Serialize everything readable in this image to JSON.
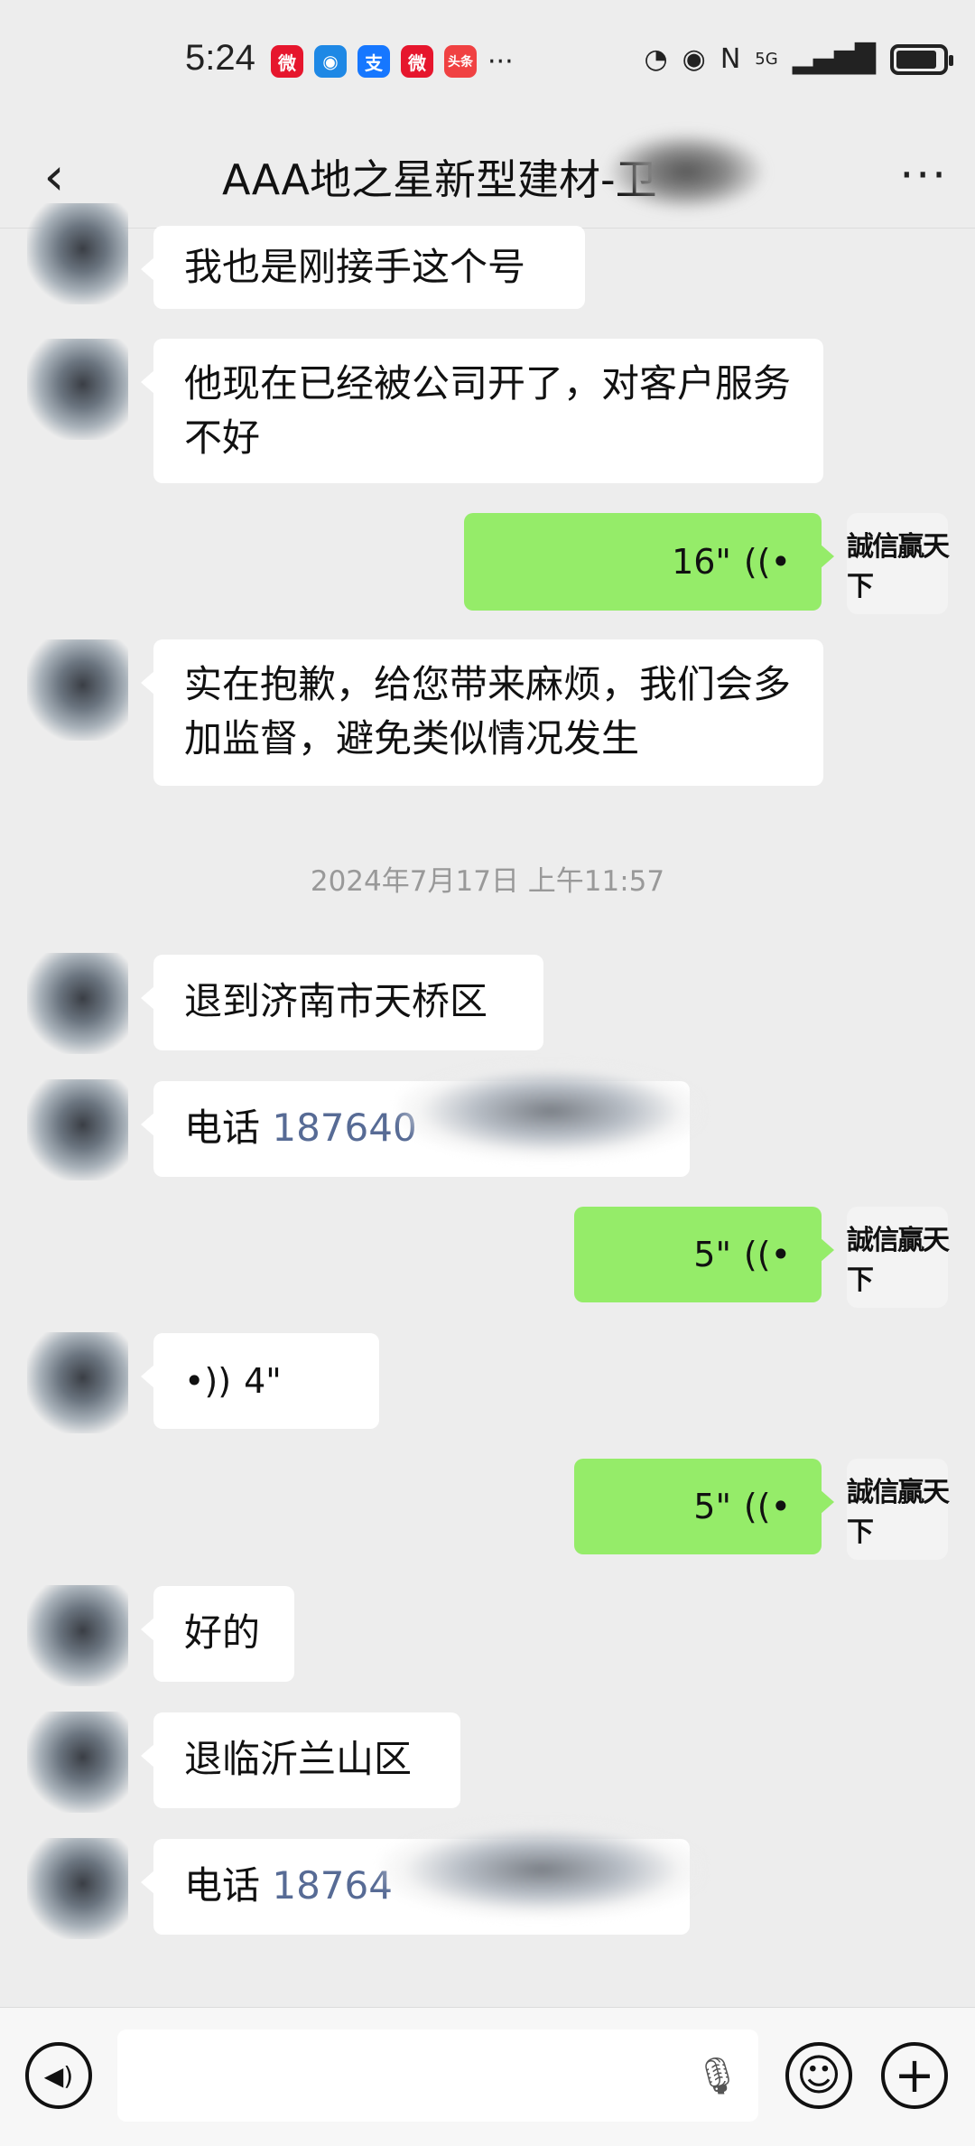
{
  "status": {
    "time": "5:24",
    "apps": [
      {
        "name": "weibo-icon",
        "glyph": "微",
        "color": "#e6162d"
      },
      {
        "name": "browser-icon",
        "glyph": "◉",
        "color": "#1e88e5"
      },
      {
        "name": "alipay-icon",
        "glyph": "支",
        "color": "#1677ff"
      },
      {
        "name": "weibo-icon",
        "glyph": "微",
        "color": "#e6162d"
      },
      {
        "name": "toutiao-icon",
        "glyph": "头条",
        "color": "#f04142"
      }
    ],
    "more": "···",
    "network": "5G"
  },
  "header": {
    "title": "AAA地之星新型建材-卫",
    "back": "‹",
    "more": "···"
  },
  "messages": {
    "m1": "我也是刚接手这个号",
    "m2": "他现在已经被公司开了，对客户服务不好",
    "v1": "16\"",
    "m3": "实在抱歉，给您带来麻烦，我们会多加监督，避免类似情况发生",
    "timestamp": "2024年7月17日 上午11:57",
    "m4": "退到济南市天桥区",
    "m5_label": "电话 ",
    "m5_num": "187640",
    "v2": "5\"",
    "v3": "4\"",
    "v4": "5\"",
    "m6": "好的",
    "m7": "退临沂兰山区",
    "m8_label": "电话 ",
    "m8_num": "18764",
    "avatar_right_text": "誠信贏天下"
  },
  "input": {
    "voice_toggle": "◀)",
    "emoji": "☺",
    "plus": "+"
  }
}
